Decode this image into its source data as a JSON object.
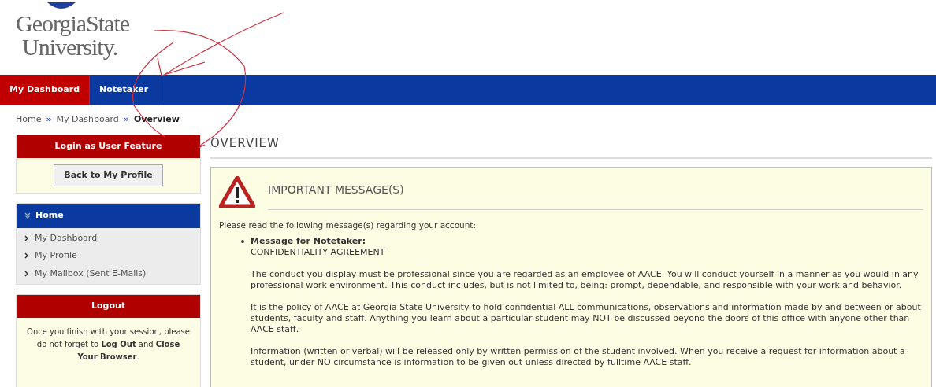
{
  "logo": {
    "line_1": "GeorgiaState",
    "line_2": "University."
  },
  "nav_tabs": [
    {
      "label": "My Dashboard",
      "selected": true
    },
    {
      "label": "Notetaker",
      "selected": false
    }
  ],
  "breadcrumb": [
    {
      "label": "Home",
      "current": false
    },
    {
      "label": "My Dashboard",
      "current": false
    },
    {
      "label": "Overview",
      "current": true
    }
  ],
  "breadcrumb_separator": "»",
  "sidebar": {
    "login_panel": {
      "title": "Login as User Feature",
      "button": "Back to My Profile"
    },
    "home_panel": {
      "title": "Home",
      "items": [
        "My Dashboard",
        "My Profile",
        "My Mailbox (Sent E-Mails)"
      ]
    },
    "logout_panel": {
      "title": "Logout",
      "text": "Once you finish with your session, please do not forget to **Log Out** and **Close Your Browser**."
    }
  },
  "main": {
    "heading": "OVERVIEW",
    "message_box": {
      "title": "IMPORTANT MESSAGE(S)",
      "intro": "Please read the following message(s) regarding your account:",
      "messages": [
        {
          "title": "Message for Notetaker:",
          "subtitle": "CONFIDENTIALITY AGREEMENT",
          "paragraphs": [
            "The conduct you display must be professional since you are regarded as an employee of AACE. You will conduct yourself in a manner as you would in any professional work environment. This conduct includes, but is not limited to, being: prompt, dependable, and responsible with your work and behavior.",
            "It is the policy of AACE at Georgia State University to hold confidential ALL communications, observations and information made by and between or about students, faculty and staff. Anything you learn about a particular student may NOT be discussed beyond the doors of this office with anyone other than AACE staff.",
            "Information (written or verbal) will be released only by written permission of the student involved. When you receive a request for information about a student, under NO circumstance is information to be given out unless directed by fulltime AACE staff."
          ]
        }
      ]
    }
  }
}
